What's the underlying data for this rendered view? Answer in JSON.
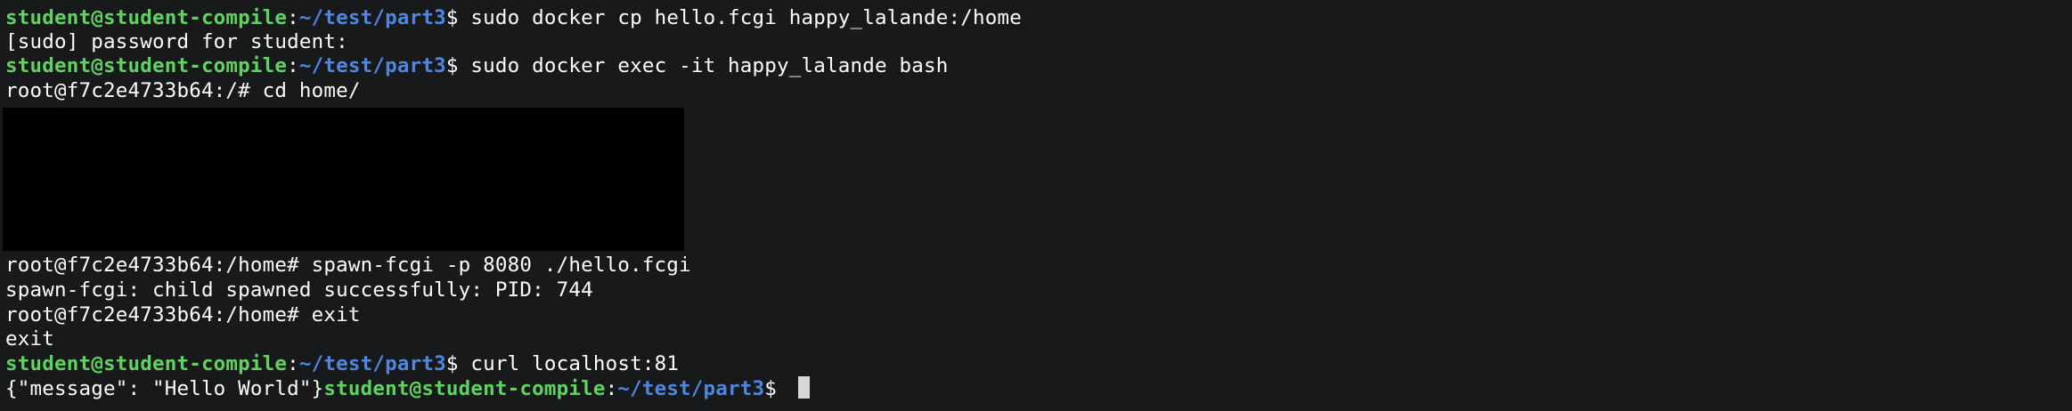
{
  "terminal": {
    "prompt": {
      "user_host": "student@student-compile",
      "separator": ":",
      "path": "~/test/part3",
      "symbol": "$ "
    },
    "lines": [
      {
        "kind": "prompt",
        "command": "sudo docker cp hello.fcgi happy_lalande:/home"
      },
      {
        "kind": "output",
        "text": "[sudo] password for student:"
      },
      {
        "kind": "prompt",
        "command": "sudo docker exec -it happy_lalande bash"
      },
      {
        "kind": "output",
        "text": "root@f7c2e4733b64:/# cd home/"
      },
      {
        "kind": "output",
        "text": "root@f7c2e4733b64:/home# spawn-fcgi -p 8080 ./hello.fcgi"
      },
      {
        "kind": "output",
        "text": "spawn-fcgi: child spawned successfully: PID: 744"
      },
      {
        "kind": "output",
        "text": "root@f7c2e4733b64:/home# exit"
      },
      {
        "kind": "output",
        "text": "exit"
      },
      {
        "kind": "prompt",
        "command": "curl localhost:81"
      },
      {
        "kind": "output-prompt",
        "text": "{\"message\": \"Hello World\"}"
      }
    ]
  },
  "colors": {
    "background": "#18191b",
    "user_host": "#5fd35f",
    "path": "#4f86e0",
    "text": "#ffffff",
    "cursor": "#d8d8d8",
    "redaction": "#000000"
  }
}
